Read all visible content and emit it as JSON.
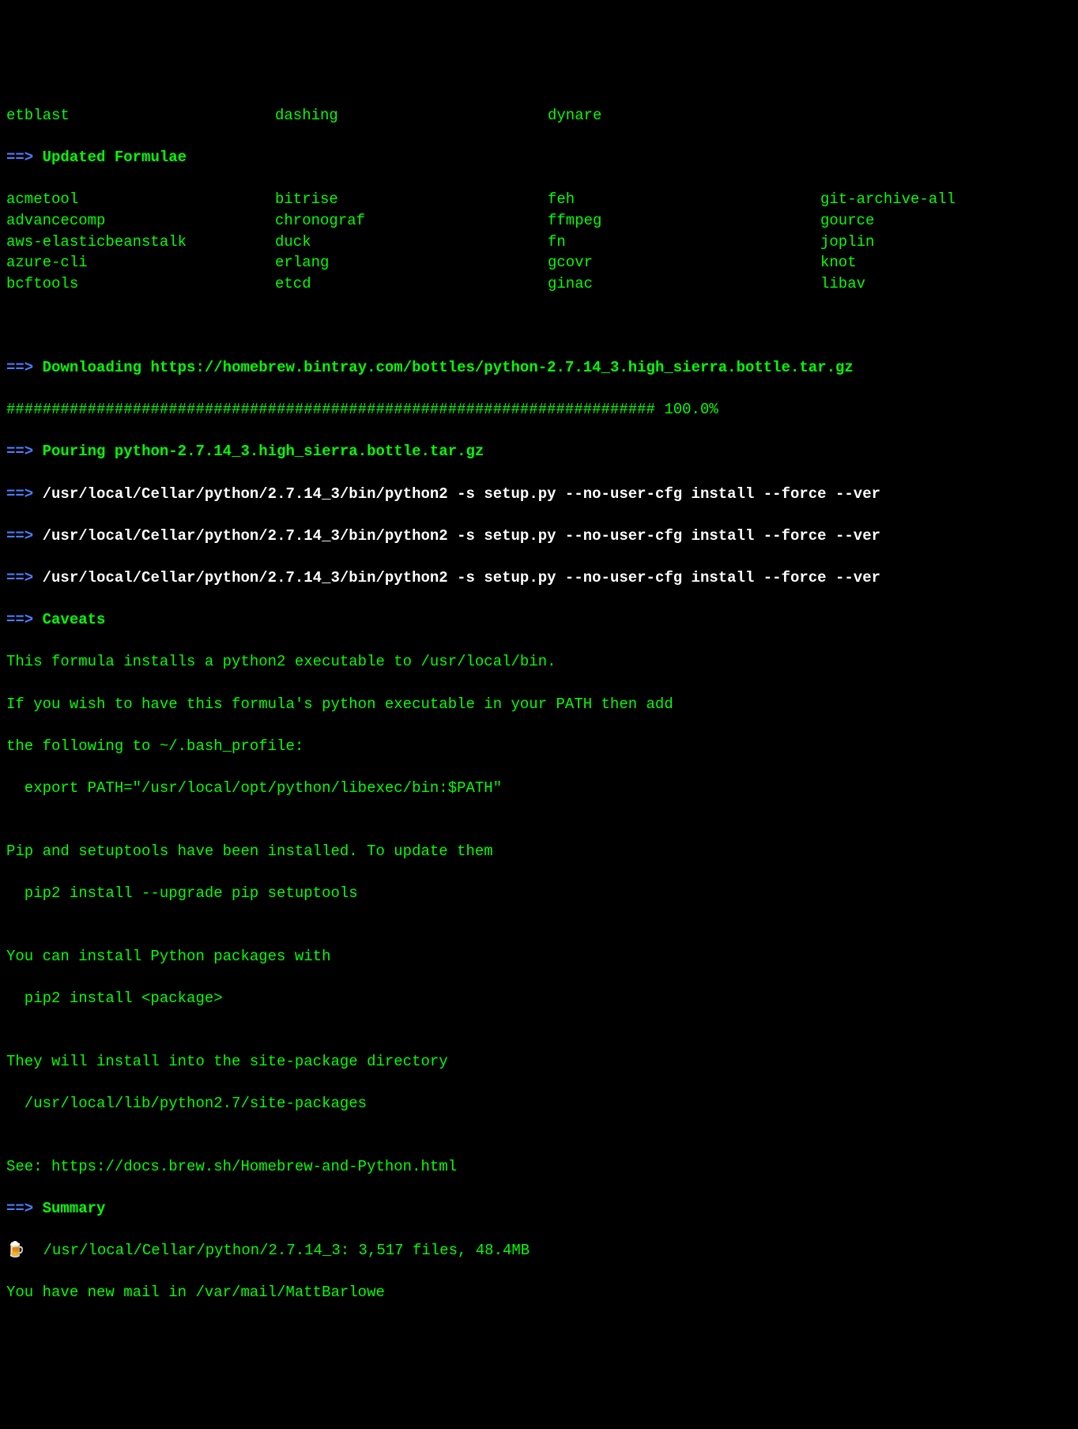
{
  "top_partial": {
    "col1": "etblast",
    "col2": "dashing",
    "col3": "dynare"
  },
  "updated_header": "Updated Formulae",
  "arrow": "==>",
  "formulae": {
    "col1": [
      "acmetool",
      "advancecomp",
      "aws-elasticbeanstalk",
      "azure-cli",
      "bcftools"
    ],
    "col2": [
      "bitrise",
      "chronograf",
      "duck",
      "erlang",
      "etcd"
    ],
    "col3": [
      "feh",
      "ffmpeg",
      "fn",
      "gcovr",
      "ginac"
    ],
    "col4": [
      "git-archive-all",
      "gource",
      "joplin",
      "knot",
      "libav"
    ]
  },
  "downloading": {
    "label": "Downloading",
    "url": "https://homebrew.bintray.com/bottles/python-2.7.14_3.high_sierra.bottle.tar.gz"
  },
  "progress": {
    "bar": "########################################################################",
    "percent": "100.0%"
  },
  "pouring": {
    "label": "Pouring",
    "file": "python-2.7.14_3.high_sierra.bottle.tar.gz"
  },
  "setup_cmd": "/usr/local/Cellar/python/2.7.14_3/bin/python2 -s setup.py --no-user-cfg install --force --ver",
  "caveats_header": "Caveats",
  "caveats_text": [
    "This formula installs a python2 executable to /usr/local/bin.",
    "If you wish to have this formula's python executable in your PATH then add",
    "the following to ~/.bash_profile:",
    "  export PATH=\"/usr/local/opt/python/libexec/bin:$PATH\"",
    "",
    "Pip and setuptools have been installed. To update them",
    "  pip2 install --upgrade pip setuptools",
    "",
    "You can install Python packages with",
    "  pip2 install <package>",
    "",
    "They will install into the site-package directory",
    "  /usr/local/lib/python2.7/site-packages",
    "",
    "See: https://docs.brew.sh/Homebrew-and-Python.html"
  ],
  "summary_header": "Summary",
  "summary_icon": "🍺",
  "summary_text": "/usr/local/Cellar/python/2.7.14_3: 3,517 files, 48.4MB",
  "mail_text": "You have new mail in /var/mail/MattBarlowe"
}
